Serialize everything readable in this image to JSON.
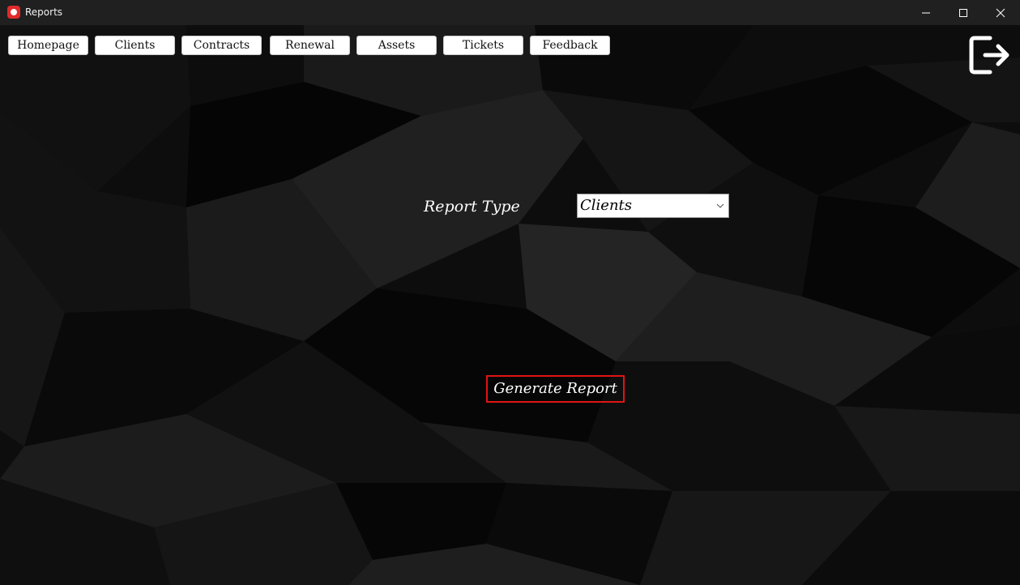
{
  "window": {
    "title": "Reports"
  },
  "nav": {
    "items": [
      {
        "label": "Homepage"
      },
      {
        "label": "Clients"
      },
      {
        "label": "Contracts"
      },
      {
        "label": "Renewal"
      },
      {
        "label": "Assets"
      },
      {
        "label": "Tickets"
      },
      {
        "label": "Feedback"
      }
    ]
  },
  "form": {
    "report_type_label": "Report Type",
    "report_type_value": "Clients",
    "generate_label": "Generate Report"
  },
  "icons": {
    "app": "app-icon",
    "logout": "logout-icon",
    "minimize": "minimize-icon",
    "maximize": "maximize-icon",
    "close": "close-icon",
    "dropdown": "chevron-down-icon"
  },
  "colors": {
    "titlebar": "#202020",
    "accent_red": "#e01414",
    "background": "#0b0b0b"
  }
}
